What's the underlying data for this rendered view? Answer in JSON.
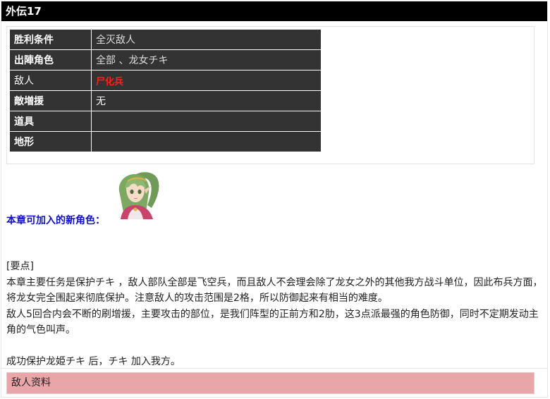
{
  "header": {
    "title": "外伝17"
  },
  "info": {
    "rows": [
      {
        "label": "胜利条件",
        "value": "全灭敌人"
      },
      {
        "label": "出陣角色",
        "value": "全部 、龙女チキ"
      },
      {
        "label": "敌人",
        "value": "尸化兵"
      },
      {
        "label": "敵増援",
        "value": "无"
      },
      {
        "label": "道具",
        "value": ""
      },
      {
        "label": "地形",
        "value": ""
      }
    ]
  },
  "new_character": {
    "label": "本章可加入的新角色："
  },
  "notes": {
    "heading": "[要点]",
    "para1": "本章主要任务是保护チキ ，敌人部队全部是飞空兵，而且敌人不会理会除了龙女之外的其他我方战斗单位，因此布兵方面，将龙女完全围起来彻底保护。注意敌人的攻击范围是2格，所以防御起来有相当的难度。",
    "para2": "敌人5回合内会不断的刷增援，主要攻击的部位，是我们阵型的正前方和2肋，这3点派最强的角色防御，同时不定期发动主角的气色叫声。",
    "para3": "成功保护龙姫チキ 后，チキ 加入我方。"
  },
  "enemy_section": {
    "label": "敌人资料"
  },
  "colors": {
    "header_bg": "#000000",
    "table_bg": "#333333",
    "highlight_red": "#ff2020",
    "link_blue": "#1010cc",
    "section_pink": "#e8a6a9"
  }
}
